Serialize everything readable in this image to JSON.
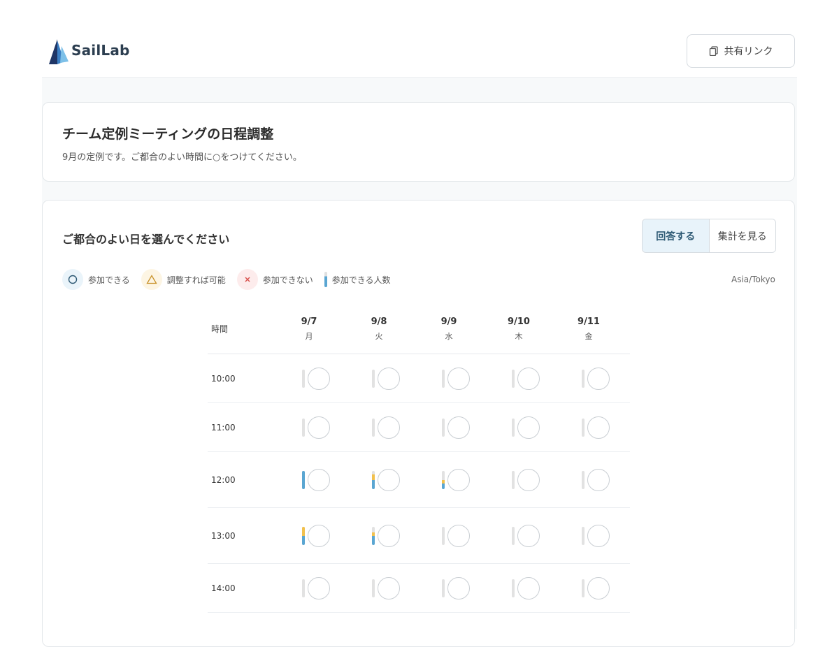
{
  "header": {
    "brand": "SailLab",
    "share_label": "共有リンク"
  },
  "event": {
    "title": "チーム定例ミーティングの日程調整",
    "description": "9月の定例です。ご都合のよい時間に○をつけてください。"
  },
  "schedule": {
    "heading": "ご都合のよい日を選んでください",
    "toggle": {
      "answer": "回答する",
      "summary": "集計を見る",
      "active": "answer"
    },
    "legend": {
      "ok": "参加できる",
      "maybe": "調整すれば可能",
      "no": "参加できない",
      "count": "参加できる人数"
    },
    "timezone": "Asia/Tokyo",
    "time_header": "時間",
    "days": [
      {
        "date": "9/7",
        "weekday": "月"
      },
      {
        "date": "9/8",
        "weekday": "火"
      },
      {
        "date": "9/9",
        "weekday": "水"
      },
      {
        "date": "9/10",
        "weekday": "木"
      },
      {
        "date": "9/11",
        "weekday": "金"
      }
    ],
    "rows": [
      {
        "time": "10:00",
        "cells": [
          {
            "ok": 0,
            "maybe": 0
          },
          {
            "ok": 0,
            "maybe": 0
          },
          {
            "ok": 0,
            "maybe": 0
          },
          {
            "ok": 0,
            "maybe": 0
          },
          {
            "ok": 0,
            "maybe": 0
          }
        ]
      },
      {
        "time": "11:00",
        "cells": [
          {
            "ok": 0,
            "maybe": 0
          },
          {
            "ok": 0,
            "maybe": 0
          },
          {
            "ok": 0,
            "maybe": 0
          },
          {
            "ok": 0,
            "maybe": 0
          },
          {
            "ok": 0,
            "maybe": 0
          }
        ]
      },
      {
        "time": "12:00",
        "cells": [
          {
            "ok": 1.0,
            "maybe": 0
          },
          {
            "ok": 0.5,
            "maybe": 0.3
          },
          {
            "ok": 0.3,
            "maybe": 0.2
          },
          {
            "ok": 0,
            "maybe": 0
          },
          {
            "ok": 0,
            "maybe": 0
          }
        ]
      },
      {
        "time": "13:00",
        "cells": [
          {
            "ok": 0.5,
            "maybe": 0.5
          },
          {
            "ok": 0.5,
            "maybe": 0.2
          },
          {
            "ok": 0,
            "maybe": 0
          },
          {
            "ok": 0,
            "maybe": 0
          },
          {
            "ok": 0,
            "maybe": 0
          }
        ]
      },
      {
        "time": "14:00",
        "cells": [
          {
            "ok": 0,
            "maybe": 0
          },
          {
            "ok": 0,
            "maybe": 0
          },
          {
            "ok": 0,
            "maybe": 0
          },
          {
            "ok": 0,
            "maybe": 0
          },
          {
            "ok": 0,
            "maybe": 0
          }
        ]
      }
    ]
  },
  "colors": {
    "ok": "#5aa6d2",
    "maybe": "#f2c14e",
    "empty": "#e2e2e2"
  }
}
